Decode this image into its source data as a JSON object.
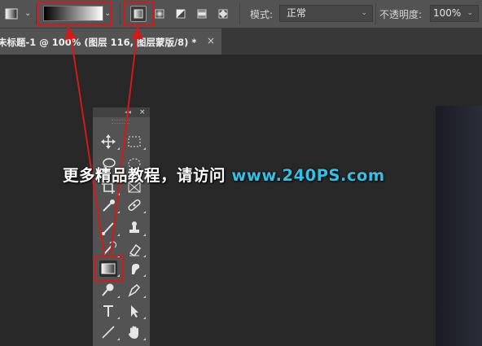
{
  "options_bar": {
    "mode_label": "模式:",
    "mode_value": "正常",
    "opacity_label": "不透明度:",
    "opacity_value": "100%",
    "gradient_type_selected": "linear-gradient-icon"
  },
  "document_tab": {
    "title": "未标题-1 @ 100% (图层 116, 图层蒙版/8) *",
    "close": "×"
  },
  "tools_panel": {
    "collapse": "◂◂",
    "close": "×",
    "selected_tool": "gradient-tool",
    "tools": [
      "move",
      "rectangular-marquee",
      "lasso",
      "magic-wand",
      "crop",
      "frame",
      "eyedropper",
      "spot-healing",
      "brush",
      "clone-stamp",
      "history-brush",
      "eraser",
      "gradient",
      "smudge",
      "dodge",
      "pen",
      "type",
      "path-selection",
      "line",
      "hand"
    ]
  },
  "watermark": {
    "prefix": "更多精品教程，请访问",
    "url": "www.240PS.com"
  },
  "annotation_color": "#d31a1a"
}
